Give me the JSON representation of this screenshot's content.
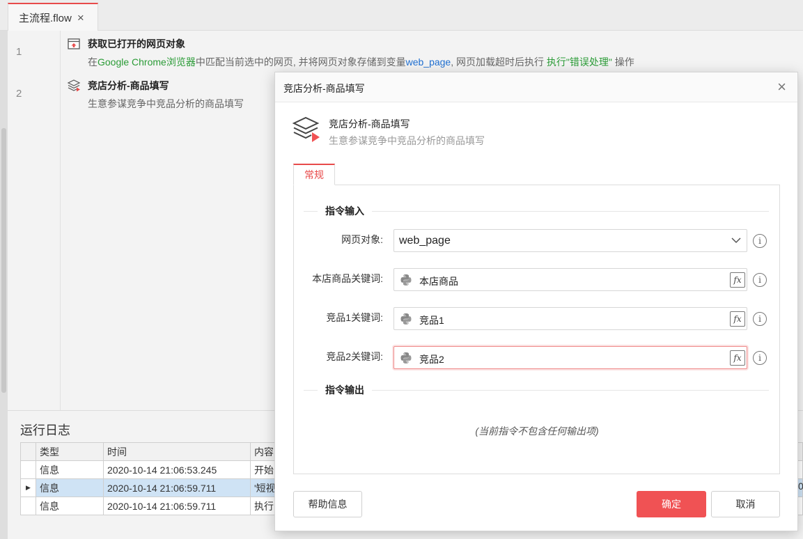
{
  "tab": {
    "label": "主流程.flow",
    "close": "×"
  },
  "flow": {
    "lines": [
      {
        "number": "1",
        "title": "获取已打开的网页对象",
        "desc_parts": [
          "在",
          "Google Chrome浏览器",
          "中匹配当前选中的网页, 并将网页对象存储到变量",
          "web_page",
          ", 网页加载超时后执行 ",
          "执行\"错误处理\"",
          " 操作"
        ]
      },
      {
        "number": "2",
        "title": "竞店分析-商品填写",
        "desc": "生意参谋竞争中竞品分析的商品填写"
      }
    ]
  },
  "log": {
    "title": "运行日志",
    "headers": [
      "类型",
      "时间",
      "内容"
    ],
    "rows": [
      {
        "type": "信息",
        "time": "2020-10-14 21:06:53.245",
        "content": "开始"
      },
      {
        "type": "信息",
        "time": "2020-10-14 21:06:59.711",
        "content": "'短视"
      },
      {
        "type": "信息",
        "time": "2020-10-14 21:06:59.711",
        "content": "执行"
      }
    ],
    "right_cut": "0"
  },
  "dialog": {
    "title": "竞店分析-商品填写",
    "command_name": "竞店分析-商品填写",
    "command_desc": "生意参谋竞争中竞品分析的商品填写",
    "tab_general": "常规",
    "section_input": "指令输入",
    "section_output": "指令输出",
    "fields": {
      "web_object": {
        "label": "网页对象:",
        "value": "web_page"
      },
      "store_keyword": {
        "label": "本店商品关键词:",
        "value": "本店商品"
      },
      "comp1_keyword": {
        "label": "竞品1关键词:",
        "value": "竞品1"
      },
      "comp2_keyword": {
        "label": "竞品2关键词:",
        "value": "竞品2"
      }
    },
    "fx_label": "fx",
    "info_label": "i",
    "no_output": "(当前指令不包含任何输出项)",
    "help_button": "帮助信息",
    "ok_button": "确定",
    "cancel_button": "取消",
    "close": "×"
  }
}
